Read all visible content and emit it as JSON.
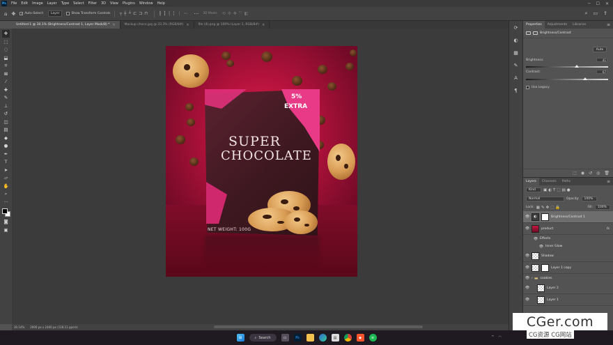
{
  "app": {
    "logo": "Ps",
    "menu": [
      "File",
      "Edit",
      "Image",
      "Layer",
      "Type",
      "Select",
      "Filter",
      "3D",
      "View",
      "Plugins",
      "Window",
      "Help"
    ]
  },
  "options": {
    "auto_select_label": "Auto-Select:",
    "auto_select_target": "Layer",
    "transform_label": "Show Transform Controls",
    "mode_label": "3D Mode:"
  },
  "tabs": [
    {
      "label": "Untitled-1 @ 30.1% (Brightness/Contrast 1, Layer Mask/8) *",
      "active": true
    },
    {
      "label": "Mockup choco.jpg @ 33.3% (RGB/8#)",
      "active": false
    },
    {
      "label": "file (4).png @ 100% (Layer 1, RGB/8#)",
      "active": false
    }
  ],
  "artwork": {
    "extra_pct": "5%",
    "extra_word": "EXTRA",
    "brand_line1": "SUPER",
    "brand_line2": "CHOCOLATE",
    "net_weight": "NET WEIGHT: 100G"
  },
  "status": {
    "zoom": "30.14%",
    "doc_info": "2000 px x 2400 px (118.11 ppcm)"
  },
  "properties": {
    "tabs": [
      "Properties",
      "Adjustments",
      "Libraries"
    ],
    "adjustment": "Brightness/Contrast",
    "auto_label": "Auto",
    "brightness_label": "Brightness:",
    "brightness_value": "41",
    "brightness_fraction": 0.62,
    "contrast_label": "Contrast:",
    "contrast_value": "67",
    "contrast_fraction": 0.72,
    "legacy_label": "Use Legacy"
  },
  "layers_panel": {
    "tabs": [
      "Layers",
      "Channels",
      "Paths"
    ],
    "filter_kind": "Kind",
    "blend_mode": "Normal",
    "opacity_label": "Opacity:",
    "opacity_value": "100%",
    "lock_label": "Lock:",
    "fill_label": "Fill:",
    "fill_value": "100%",
    "layers": [
      {
        "name": "Brightness/Contrast 1",
        "kind": "adjustment",
        "selected": true
      },
      {
        "name": "product",
        "kind": "smart",
        "fx": "fx"
      },
      {
        "name": "Effects",
        "kind": "sub"
      },
      {
        "name": "Inner Glow",
        "kind": "sub"
      },
      {
        "name": "Shadow",
        "kind": "pixel"
      },
      {
        "name": "Layer 1 copy",
        "kind": "masked"
      },
      {
        "name": "cookies",
        "kind": "group"
      },
      {
        "name": "Layer 2",
        "kind": "pixel"
      },
      {
        "name": "Layer 1",
        "kind": "pixel"
      }
    ]
  },
  "watermark": {
    "main": "CGer.com",
    "sub": "CG资源 CG网站"
  },
  "taskbar": {
    "search_label": "Search"
  },
  "colors": {
    "accent": "#31a8ff",
    "canvas_bg": "#3b3b3b",
    "artwork_red": "#c41842",
    "bag_brown": "#3e1820",
    "bag_pink": "#e83a86"
  }
}
